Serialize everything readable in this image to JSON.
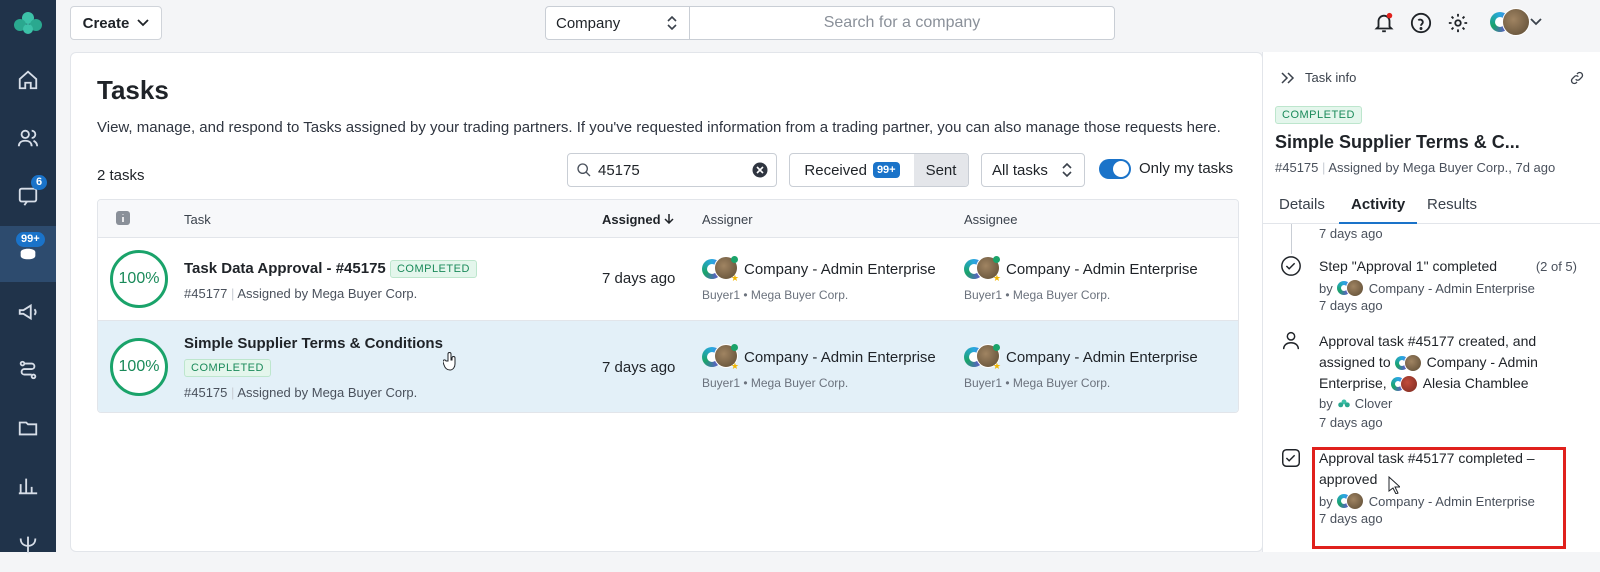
{
  "topbar": {
    "create_label": "Create",
    "scope_select": "Company",
    "search_placeholder": "Search for a company"
  },
  "rail": {
    "messages_badge": "6",
    "tasks_badge": "99+"
  },
  "main": {
    "title": "Tasks",
    "description": "View, manage, and respond to Tasks assigned by your trading partners. If you've requested information from a trading partner, you can also manage those requests here.",
    "count": "2 tasks",
    "search_value": "45175",
    "received_label": "Received",
    "received_badge": "99+",
    "sent_label": "Sent",
    "filter_label": "All tasks",
    "only_mine_label": "Only my tasks"
  },
  "table": {
    "headers": {
      "task": "Task",
      "assigned": "Assigned",
      "assigner": "Assigner",
      "assignee": "Assignee"
    },
    "rows": [
      {
        "progress": "100%",
        "name": "Task Data Approval - #45175",
        "status": "COMPLETED",
        "id": "#45177",
        "assigned_by": "Assigned by Mega Buyer Corp.",
        "assigned": "7 days ago",
        "assigner": "Company - Admin Enterprise",
        "assigner_sub": "Buyer1 • Mega Buyer Corp.",
        "assignee": "Company - Admin Enterprise",
        "assignee_sub": "Buyer1 • Mega Buyer Corp."
      },
      {
        "progress": "100%",
        "name": "Simple Supplier Terms & Conditions",
        "status": "COMPLETED",
        "id": "#45175",
        "assigned_by": "Assigned by Mega Buyer Corp.",
        "assigned": "7 days ago",
        "assigner": "Company - Admin Enterprise",
        "assigner_sub": "Buyer1 • Mega Buyer Corp.",
        "assignee": "Company - Admin Enterprise",
        "assignee_sub": "Buyer1 • Mega Buyer Corp."
      }
    ]
  },
  "panel": {
    "header": "Task info",
    "status": "COMPLETED",
    "title": "Simple Supplier Terms & C...",
    "id": "#45175",
    "meta": "Assigned by Mega Buyer Corp., 7d ago",
    "tabs": [
      "Details",
      "Activity",
      "Results"
    ],
    "events": [
      {
        "time": "7 days ago"
      },
      {
        "text": "Step \"Approval 1\" completed",
        "step": "(2 of 5)",
        "by": "by",
        "actor": "Company - Admin Enterprise",
        "time": "7 days ago"
      },
      {
        "text1": "Approval task #45177 created, and",
        "text2a": "assigned to",
        "actor_a": "Company - Admin",
        "text3": "Enterprise,",
        "actor_b": "Alesia Chamblee",
        "by": "by",
        "actor": "Clover",
        "time": "7 days ago"
      },
      {
        "text1": "Approval task #45177 completed –",
        "text2": "approved",
        "by": "by",
        "actor": "Company - Admin Enterprise",
        "time": "7 days ago"
      }
    ]
  }
}
